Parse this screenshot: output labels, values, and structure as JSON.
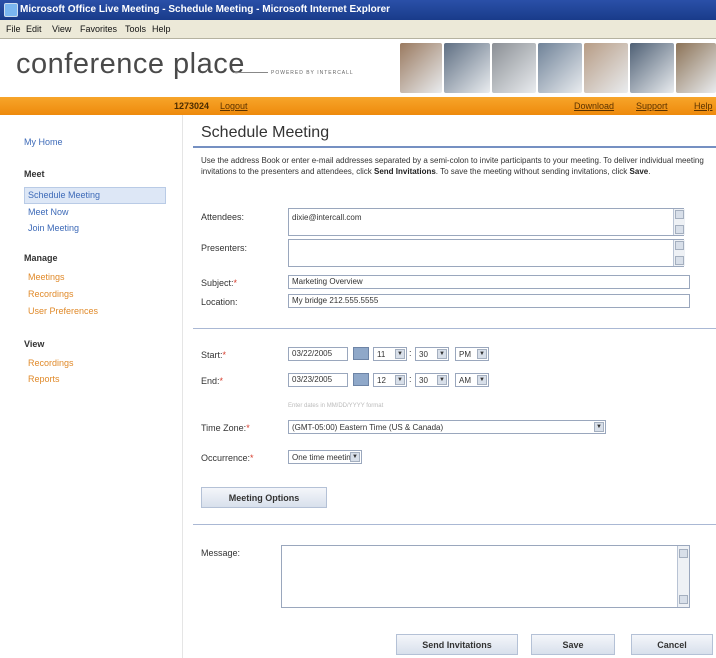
{
  "window": {
    "title": "Microsoft Office Live Meeting - Schedule Meeting - Microsoft Internet Explorer"
  },
  "menu": [
    "File",
    "Edit",
    "View",
    "Favorites",
    "Tools",
    "Help"
  ],
  "header": {
    "logo_text": "conference place",
    "tagline": "POWERED BY INTERCALL",
    "photo_colors": [
      "#9a7a60",
      "#5f6f83",
      "#8b8f95",
      "#6f8298",
      "#b79c85",
      "#4f6075",
      "#8c7357"
    ]
  },
  "topbar": {
    "user_id": "1273024",
    "logout": "Logout",
    "download": "Download",
    "support": "Support",
    "help": "Help"
  },
  "sidebar": {
    "my_home": "My Home",
    "meet_heading": "Meet",
    "meet_items": [
      "Schedule Meeting",
      "Meet Now",
      "Join Meeting"
    ],
    "manage_heading": "Manage",
    "manage_items": [
      "Meetings",
      "Recordings",
      "User Preferences"
    ],
    "view_heading": "View",
    "view_items": [
      "Recordings",
      "Reports"
    ]
  },
  "main": {
    "title": "Schedule Meeting",
    "intro_pre": "Use the address Book or enter e-mail addresses separated by a semi-colon to invite participants to your meeting. To deliver individual meeting invitations to the presenters and attendees, click ",
    "intro_bold1": "Send Invitations",
    "intro_mid": ". To save the meeting without sending invitations, click ",
    "intro_bold2": "Save",
    "intro_end": ".",
    "attendees_label": "Attendees:",
    "attendees_value": "dixie@intercall.com",
    "presenters_label": "Presenters:",
    "presenters_value": "",
    "subject_label": "Subject:",
    "subject_value": "Marketing Overview",
    "location_label": "Location:",
    "location_value": "My bridge 212.555.5555",
    "start_label": "Start:",
    "start_date": "03/22/2005",
    "start_hour": "11",
    "start_min": "30",
    "start_ampm": "PM",
    "end_label": "End:",
    "end_date": "03/23/2005",
    "end_hour": "12",
    "end_min": "30",
    "end_ampm": "AM",
    "date_hint": "Enter dates in MM/DD/YYYY format",
    "timezone_label": "Time Zone:",
    "timezone_value": "(GMT-05:00) Eastern Time (US & Canada)",
    "occurrence_label": "Occurrence:",
    "occurrence_value": "One time meeting",
    "meeting_options": "Meeting Options",
    "message_label": "Message:",
    "message_value": "",
    "send_button": "Send Invitations",
    "save_button": "Save",
    "cancel_button": "Cancel",
    "required_mark": "*"
  }
}
